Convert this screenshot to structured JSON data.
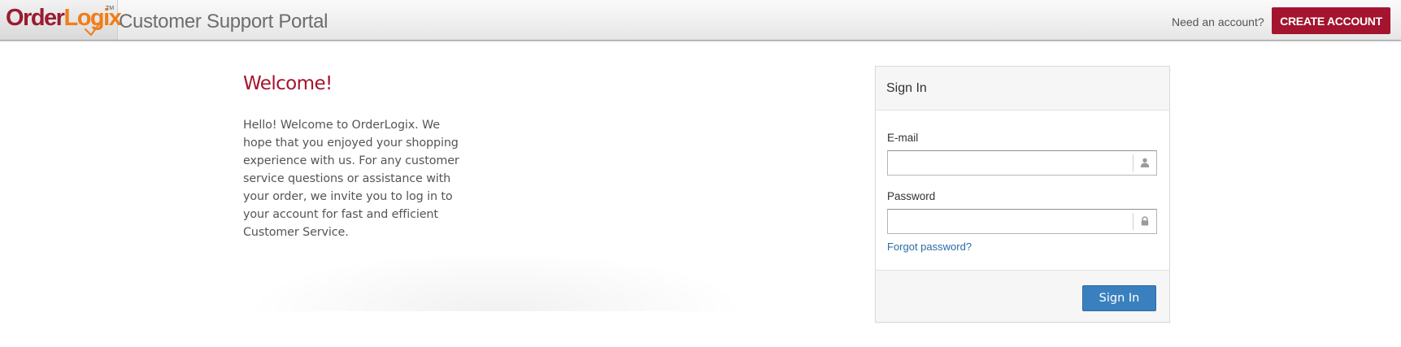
{
  "header": {
    "logo_order": "Order",
    "logo_logix": "Logix",
    "logo_tm": "TM",
    "portal_title": "Customer Support Portal",
    "need_account": "Need an account?",
    "create_account_label": "CREATE ACCOUNT"
  },
  "welcome": {
    "title": "Welcome!",
    "body": "Hello! Welcome to OrderLogix. We hope that you enjoyed your shopping experience with us.  For any customer service questions or assistance with your order, we invite you to log in to your account for fast and efficient Customer Service."
  },
  "signin": {
    "title": "Sign In",
    "email_label": "E-mail",
    "email_value": "",
    "email_icon": "user-icon",
    "password_label": "Password",
    "password_value": "",
    "password_icon": "lock-icon",
    "forgot_label": "Forgot password?",
    "submit_label": "Sign In"
  },
  "colors": {
    "brand": "#a4142e",
    "logo_accent": "#f07d1a",
    "link": "#2c6aa6",
    "primary_button": "#3a80bf"
  }
}
